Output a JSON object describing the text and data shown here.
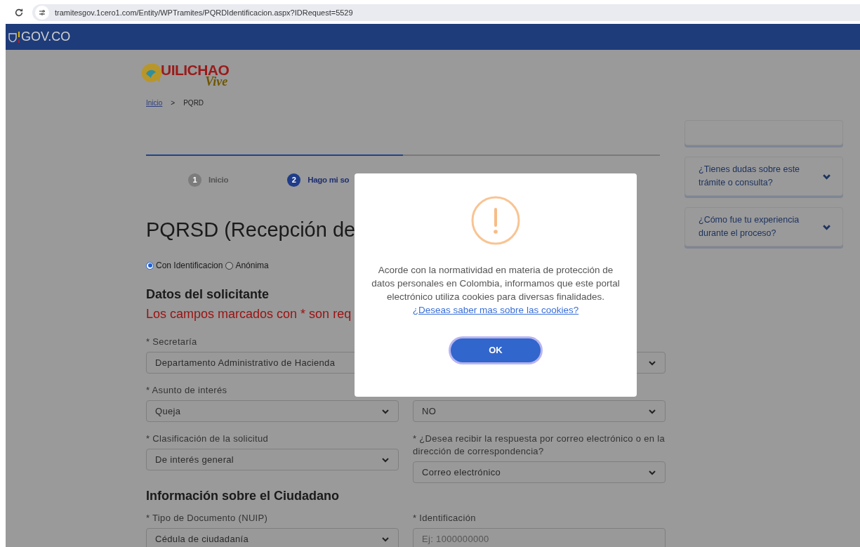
{
  "browser": {
    "url": "tramitesgov.1cero1.com/Entity/WPTramites/PQRDIdentificacion.aspx?IDRequest=5529"
  },
  "gov_bar": {
    "brand": "GOV.CO"
  },
  "logo": {
    "text": "UILICHAO",
    "script": "Vive"
  },
  "breadcrumb": [
    {
      "label": "Inicio",
      "link": true
    },
    {
      "label": ">",
      "link": false
    },
    {
      "label": "PQRD",
      "link": false
    }
  ],
  "progress": {
    "level": 0.5
  },
  "steps": [
    {
      "number": "1",
      "label": "Inicio",
      "selected": false
    },
    {
      "number": "2",
      "label": "Hago mi so",
      "selected": true
    }
  ],
  "title": "PQRSD (Recepción de",
  "identity_options": [
    {
      "label": "Con Identificacion",
      "selected": true
    },
    {
      "label": "Anónima",
      "selected": false
    }
  ],
  "section_heading": "Datos del solicitante",
  "required_note": "Los campos marcados con * son req",
  "rows": [
    [
      {
        "kind": "select",
        "label": "* Secretaría",
        "value": "Departamento Administrativo de Hacienda"
      },
      {
        "kind": "select"
      }
    ],
    [
      {
        "kind": "select",
        "label": "* Asunto de interés",
        "value": "Queja"
      },
      {
        "kind": "select",
        "value": "NO"
      }
    ],
    [
      {
        "kind": "select",
        "label": "* Clasificación de la solicitud",
        "value": "De interés general"
      },
      {
        "kind": "select",
        "label": "* ¿Desea recibir la respuesta por correo electrónico o en la dirección de correspondencia?",
        "value": "Correo electrónico"
      }
    ]
  ],
  "section_heading_2": "Información sobre el Ciudadano",
  "rows_2": [
    [
      {
        "kind": "select",
        "label": "* Tipo de Documento (NUIP)",
        "value": "Cédula de ciudadanía"
      },
      {
        "kind": "input",
        "label": "* Identificación",
        "placeholder": "Ej: 1000000000"
      }
    ]
  ],
  "sidebar": [
    {
      "kind": "blank"
    },
    {
      "kind": "accordion",
      "label": "¿Tienes dudas sobre este trámite o consulta?",
      "expanded": false
    },
    {
      "kind": "accordion",
      "label": "¿Cómo fue tu experiencia durante el proceso?",
      "expanded": false
    }
  ],
  "modal": {
    "message": "Acorde con la normatividad en materia de protección de datos personales en Colombia, informamos que este portal electrónico utiliza cookies para diversas finalidades.",
    "link": "¿Deseas saber mas sobre las cookies?",
    "button": "OK"
  }
}
